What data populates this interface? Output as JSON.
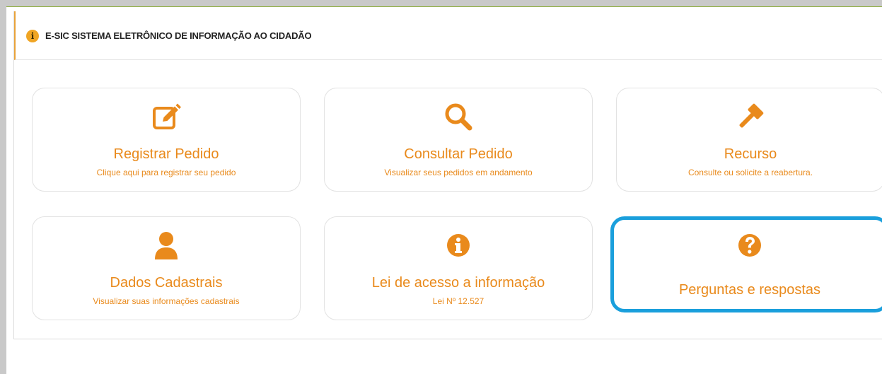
{
  "header": {
    "title": "E-SIC SISTEMA ELETRÔNICO DE INFORMAÇÃO AO CIDADÃO",
    "icon": "info-icon"
  },
  "accent_color": "#e98a1c",
  "highlight_color": "#1a9fdc",
  "tiles": [
    {
      "icon": "edit-icon",
      "title": "Registrar Pedido",
      "subtitle": "Clique aqui para registrar seu pedido"
    },
    {
      "icon": "search-icon",
      "title": "Consultar Pedido",
      "subtitle": "Visualizar seus pedidos em andamento"
    },
    {
      "icon": "gavel-icon",
      "title": "Recurso",
      "subtitle": "Consulte ou solicite a reabertura."
    },
    {
      "icon": "user-icon",
      "title": "Dados Cadastrais",
      "subtitle": "Visualizar suas informações cadastrais"
    },
    {
      "icon": "info-circle-icon",
      "title": "Lei de acesso a informação",
      "subtitle": "Lei Nº 12.527"
    },
    {
      "icon": "question-circle-icon",
      "title": "Perguntas e respostas",
      "subtitle": "",
      "highlighted": true
    }
  ]
}
